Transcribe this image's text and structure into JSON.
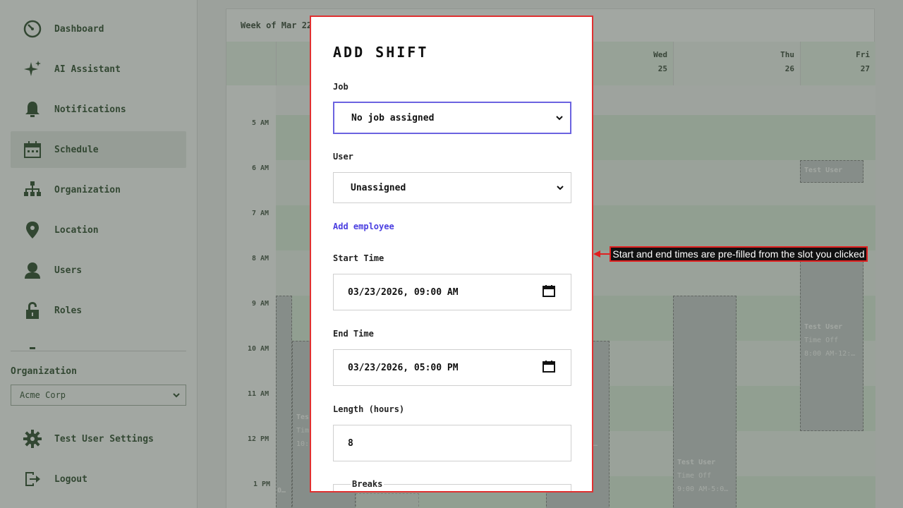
{
  "sidebar": {
    "items": [
      {
        "label": "Dashboard",
        "icon": "dashboard-icon"
      },
      {
        "label": "AI Assistant",
        "icon": "sparkle-icon"
      },
      {
        "label": "Notifications",
        "icon": "bell-icon"
      },
      {
        "label": "Schedule",
        "icon": "calendar-icon",
        "active": true
      },
      {
        "label": "Organization",
        "icon": "org-chart-icon"
      },
      {
        "label": "Location",
        "icon": "map-pin-icon"
      },
      {
        "label": "Users",
        "icon": "user-icon"
      },
      {
        "label": "Roles",
        "icon": "lock-icon"
      }
    ],
    "org_label": "Organization",
    "org_value": "Acme Corp",
    "settings_label": "Test User Settings",
    "logout_label": "Logout"
  },
  "calendar": {
    "title": "Week of Mar 22",
    "days": [
      {
        "name": "Wed",
        "num": "25"
      },
      {
        "name": "Thu",
        "num": "26"
      },
      {
        "name": "Fri",
        "num": "27"
      }
    ],
    "hours": [
      "5 AM",
      "6 AM",
      "7 AM",
      "8 AM",
      "9 AM",
      "10 AM",
      "11 AM",
      "12 PM",
      "1 PM"
    ],
    "shifts": [
      {
        "user": "Test User"
      },
      {
        "user": "Test User",
        "type": "Time Off",
        "time": "8:00 AM-12:…"
      },
      {
        "user": "Test User",
        "type": "Time Off",
        "time": "9:00 AM-5:0…"
      },
      {
        "user": "Tes",
        "type": "Tim",
        "time": "10:"
      }
    ],
    "fragments": [
      "0…",
      "…"
    ]
  },
  "modal": {
    "title": "ADD SHIFT",
    "job_label": "Job",
    "job_value": "No job assigned",
    "user_label": "User",
    "user_value": "Unassigned",
    "add_employee": "Add employee",
    "start_label": "Start Time",
    "start_value": "03/23/2026, 09:00 AM",
    "end_label": "End Time",
    "end_value": "03/23/2026, 05:00 PM",
    "length_label": "Length (hours)",
    "length_value": "8",
    "breaks_label": "Breaks"
  },
  "annotation": {
    "text": "Start and end times are pre-filled from the slot you clicked"
  },
  "colors": {
    "accent": "#6b63e0",
    "link": "#4a3ee0",
    "annotation": "#e02020",
    "calendar_green": "#e9f4e9",
    "sidebar_text": "#1f3f1f"
  }
}
